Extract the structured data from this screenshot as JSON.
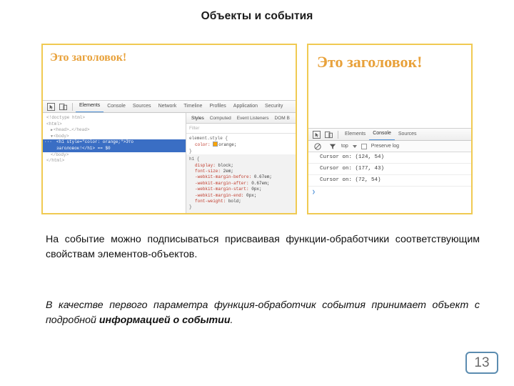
{
  "slide": {
    "title": "Объекты и события",
    "page_number": "13"
  },
  "shot_left": {
    "page_heading": "Это заголовок!",
    "devtools": {
      "tabs": [
        "Elements",
        "Console",
        "Sources",
        "Network",
        "Timeline",
        "Profiles",
        "Application",
        "Security"
      ],
      "active_tab": "Elements",
      "inspect_icon": "inspect-element-icon",
      "device_icon": "device-toolbar-icon",
      "dom_tree": [
        {
          "text": "<!doctype html>",
          "indent": 0,
          "selected": false,
          "arrow": ""
        },
        {
          "text": "<html>",
          "indent": 0,
          "selected": false,
          "arrow": ""
        },
        {
          "text": "<head>…</head>",
          "indent": 1,
          "selected": false,
          "arrow": "▶"
        },
        {
          "text": "<body>",
          "indent": 1,
          "selected": false,
          "arrow": "▼"
        },
        {
          "text": "<h1 style=\"color: orange;\">Это",
          "indent": 2,
          "selected": true,
          "arrow": ""
        },
        {
          "text": "заголовок!</h1>  == $0",
          "indent": 2,
          "selected": true,
          "arrow": ""
        },
        {
          "text": "</body>",
          "indent": 1,
          "selected": false,
          "arrow": ""
        },
        {
          "text": "</html>",
          "indent": 0,
          "selected": false,
          "arrow": ""
        }
      ],
      "styles_tabs": [
        "Styles",
        "Computed",
        "Event Listeners",
        "DOM B"
      ],
      "styles_active_tab": "Styles",
      "filter_placeholder": "Filter",
      "element_style_selector": "element.style {",
      "element_style_prop": "color:",
      "element_style_value": "orange;",
      "element_style_close": "}",
      "h1_rule_selector": "h1 {",
      "h1_rule_props": [
        {
          "prop": "display:",
          "value": "block;"
        },
        {
          "prop": "font-size:",
          "value": "2em;"
        },
        {
          "prop": "-webkit-margin-before:",
          "value": "0.67em;"
        },
        {
          "prop": "-webkit-margin-after:",
          "value": "0.67em;"
        },
        {
          "prop": "-webkit-margin-start:",
          "value": "0px;"
        },
        {
          "prop": "-webkit-margin-end:",
          "value": "0px;"
        },
        {
          "prop": "font-weight:",
          "value": "bold;"
        }
      ],
      "h1_rule_close": "}"
    }
  },
  "shot_right": {
    "page_heading": "Это заголовок!",
    "devtools": {
      "tabs": [
        "Elements",
        "Console",
        "Sources"
      ],
      "active_tab": "Console",
      "inspect_icon": "inspect-element-icon",
      "device_icon": "device-toolbar-icon",
      "clear_icon": "clear-console-icon",
      "filter_icon": "filter-funnel-icon",
      "context_label": "top",
      "preserve_log_label": "Preserve log",
      "log_rows": [
        "Cursor on: (124, 54)",
        "Cursor on: (177, 43)",
        "Cursor on: (72, 54)"
      ],
      "prompt": "❯"
    }
  },
  "content": {
    "paragraph_1": "На событие можно подписываться присваивая функции-обработчики соответствующим свойствам элементов-объектов.",
    "paragraph_2_lead": "В качестве первого параметра функция-обработчик события принимает объект с подробной ",
    "paragraph_2_bold": "информацией о событии",
    "paragraph_2_tail": "."
  },
  "colors": {
    "panel_border": "#f0ca52",
    "heading_orange": "#e8a13a",
    "devtools_accent": "#4d90d8",
    "page_num_border": "#5b8cb0"
  }
}
